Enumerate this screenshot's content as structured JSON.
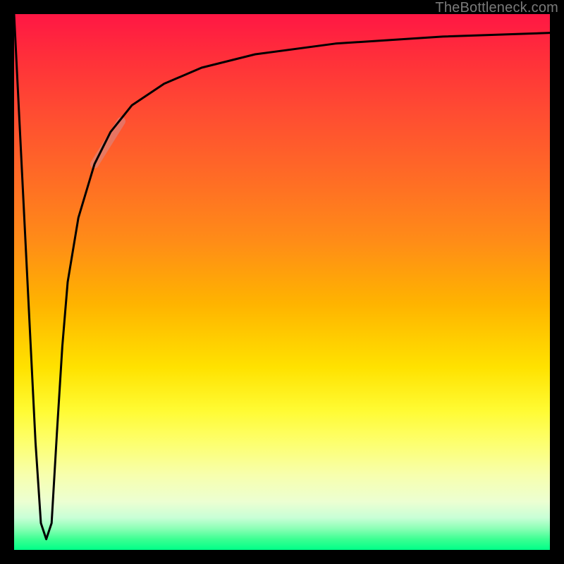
{
  "attribution": "TheBottleneck.com",
  "chart_data": {
    "type": "line",
    "title": "",
    "xlabel": "",
    "ylabel": "",
    "xlim": [
      0,
      100
    ],
    "ylim": [
      0,
      100
    ],
    "series": [
      {
        "name": "bottleneck-curve",
        "x": [
          0,
          2,
          4,
          5,
          6,
          7,
          8,
          9,
          10,
          12,
          15,
          18,
          22,
          28,
          35,
          45,
          60,
          80,
          100
        ],
        "y": [
          100,
          60,
          20,
          5,
          2,
          5,
          22,
          38,
          50,
          62,
          72,
          78,
          83,
          87,
          90,
          92.5,
          94.5,
          95.8,
          96.5
        ]
      }
    ],
    "marker": {
      "name": "highlight-segment",
      "x": [
        15,
        20
      ],
      "y": [
        72,
        80
      ]
    },
    "background_gradient": {
      "top": "#ff1744",
      "mid": "#ffe200",
      "bottom": "#00ff88"
    }
  }
}
